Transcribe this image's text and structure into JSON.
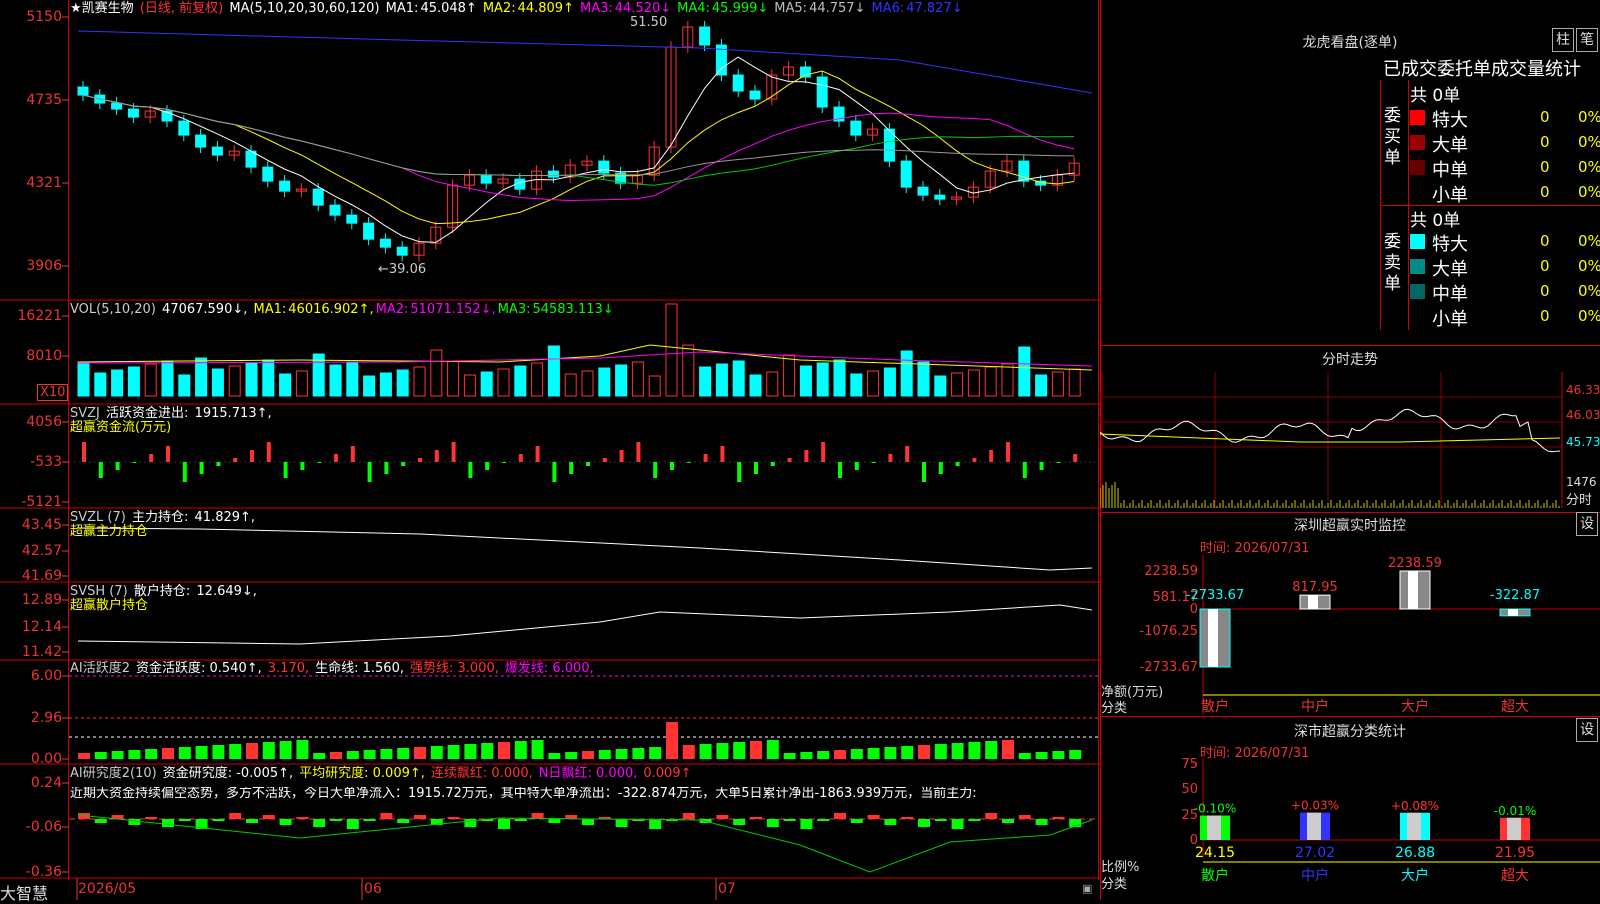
{
  "main": {
    "title": "★凯赛生物",
    "mode": "(日线, 前复权)",
    "ma_head": "MA(5,10,20,30,60,120)",
    "ma": [
      {
        "label": "MA1:",
        "value": "45.048↑",
        "color": "#ffffff"
      },
      {
        "label": "MA2:",
        "value": "44.809↑",
        "color": "#ffff00"
      },
      {
        "label": "MA3:",
        "value": "44.520↓",
        "color": "#ff00ff"
      },
      {
        "label": "MA4:",
        "value": "45.999↓",
        "color": "#00ff00"
      },
      {
        "label": "MA5:",
        "value": "44.757↓",
        "color": "#c0c0c0"
      },
      {
        "label": "MA6:",
        "value": "47.827↓",
        "color": "#3333ff"
      }
    ],
    "yticks": [
      "5150",
      "4735",
      "4321",
      "3906"
    ],
    "high_note": "51.50",
    "low_note": "←39.06"
  },
  "vol": {
    "label": "VOL(5,10,20)",
    "value": "47067.590↓,",
    "ma": [
      {
        "label": "MA1:",
        "value": "46016.902↑,",
        "color": "#ffff00"
      },
      {
        "label": "MA2:",
        "value": "51071.152↓,",
        "color": "#ff00ff"
      },
      {
        "label": "MA3:",
        "value": "54583.113↓",
        "color": "#00ff00"
      }
    ],
    "yticks": [
      "16221",
      "8010"
    ],
    "unit": "X10"
  },
  "svzj": {
    "label": "SVZJ",
    "title": "活跃资金进出:",
    "value": "1915.713↑,",
    "sub": "超赢资金流(万元)",
    "yticks": [
      "4056",
      "-533",
      "-5121"
    ]
  },
  "svzl": {
    "label": "SVZL (7)",
    "title": "主力持仓:",
    "value": "41.829↑,",
    "sub": "超赢主力持仓",
    "yticks": [
      "43.45",
      "42.57",
      "41.69"
    ]
  },
  "svsh": {
    "label": "SVSH (7)",
    "title": "散户持仓:",
    "value": "12.649↓,",
    "sub": "超赢散户持仓",
    "yticks": [
      "12.89",
      "12.14",
      "11.42"
    ]
  },
  "ai1": {
    "label": "AI活跃度2",
    "parts": [
      {
        "t": "资金活跃度: 0.540↑,",
        "c": "#ffffff"
      },
      {
        "t": "3.170,",
        "c": "#ff3333"
      },
      {
        "t": "生命线: 1.560,",
        "c": "#ffffff"
      },
      {
        "t": "强势线: 3.000,",
        "c": "#ff3333"
      },
      {
        "t": "爆发线: 6.000,",
        "c": "#ff00ff"
      }
    ],
    "yticks": [
      "6.00",
      "2.96",
      "0.00"
    ]
  },
  "ai2": {
    "label": "AI研究度2(10)",
    "parts": [
      {
        "t": "资金研究度: -0.005↑,",
        "c": "#ffffff"
      },
      {
        "t": "平均研究度: 0.009↑,",
        "c": "#ffff00"
      },
      {
        "t": "连续飘红: 0.000,",
        "c": "#ff3333"
      },
      {
        "t": "N日飘红: 0.000,",
        "c": "#ff00ff"
      },
      {
        "t": "0.009↑",
        "c": "#ff3333"
      }
    ],
    "commentary": "近期大资金持续偏空态势，多方不活跃，今日大单净流入：1915.72万元，其中特大单净流出：-322.874万元，大单5日累计净出-1863.939万元，当前主力:",
    "yticks": [
      "0.24",
      "-0.06",
      "-0.36"
    ]
  },
  "footer": {
    "brand": "大智慧",
    "dates": [
      "2026/05",
      "06",
      "07"
    ]
  },
  "longhu": {
    "title": "龙虎看盘(逐单)",
    "btn1": "柱",
    "btn2": "笔",
    "header": "已成交委托单成交量统计",
    "buy_label": "委买单",
    "sell_label": "委卖单",
    "buy_total": "共 0单",
    "sell_total": "共 0单",
    "buy_rows": [
      {
        "name": "特大",
        "n": "0",
        "p": "0%",
        "color": "#ff0000"
      },
      {
        "name": "大单",
        "n": "0",
        "p": "0%",
        "color": "#990000"
      },
      {
        "name": "中单",
        "n": "0",
        "p": "0%",
        "color": "#660000"
      },
      {
        "name": "小单",
        "n": "0",
        "p": "0%",
        "color": "#000000"
      }
    ],
    "sell_rows": [
      {
        "name": "特大",
        "n": "0",
        "p": "0%",
        "color": "#00ffff"
      },
      {
        "name": "大单",
        "n": "0",
        "p": "0%",
        "color": "#008b8b"
      },
      {
        "name": "中单",
        "n": "0",
        "p": "0%",
        "color": "#006666"
      },
      {
        "name": "小单",
        "n": "0",
        "p": "0%",
        "color": "#000000"
      }
    ]
  },
  "intraday": {
    "title": "分时走势",
    "yticks": [
      "46.33",
      "46.03",
      "45.73",
      "1476"
    ],
    "unit": "分时"
  },
  "monitor": {
    "title": "深圳超赢实时监控",
    "btn": "设",
    "time": "时间: 2026/07/31",
    "yticks": [
      "2238.59",
      "581.17",
      "0",
      "-1076.25",
      "-2733.67"
    ],
    "ylabel": "净额(万元)",
    "xlabel": "分类",
    "categories": [
      "散户",
      "中户",
      "大户",
      "超大"
    ],
    "values": [
      -2733.67,
      817.95,
      2238.59,
      -322.87
    ],
    "value_labels": [
      "-2733.67",
      "817.95",
      "2238.59",
      "-322.87"
    ]
  },
  "classify": {
    "title": "深市超赢分类统计",
    "btn": "设",
    "time": "时间: 2026/07/31",
    "yticks": [
      "75",
      "50",
      "25",
      "0"
    ],
    "ylabel": "比例%",
    "xlabel": "分类",
    "categories": [
      "散户",
      "中户",
      "大户",
      "超大"
    ],
    "values": [
      24.15,
      27.02,
      26.88,
      21.95
    ],
    "changes": [
      "-0.10%",
      "+0.03%",
      "+0.08%",
      "-0.01%"
    ],
    "colors": [
      "#00ff00",
      "#3333ff",
      "#00ffff",
      "#ff3333"
    ]
  },
  "colors": {
    "up": "#ff3333",
    "down": "#00ffff",
    "grid": "#cc0000"
  }
}
